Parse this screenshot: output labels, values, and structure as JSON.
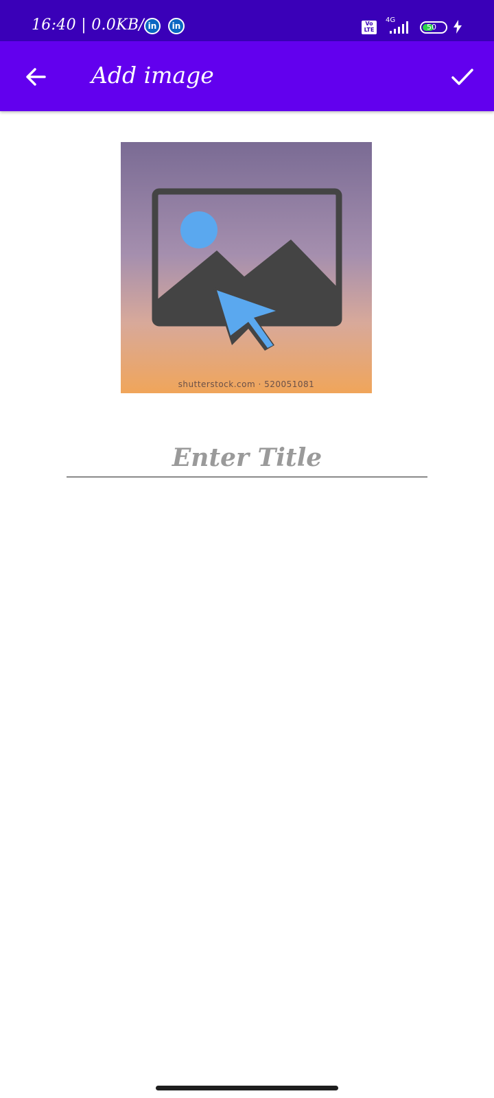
{
  "status_bar": {
    "time_speed": "16:40 | 0.0KB/s",
    "notification_icons": [
      "linkedin-icon",
      "linkedin-icon"
    ],
    "volte_label": "Vo LTE",
    "network_type": "4G",
    "battery_level": "50",
    "charging": true
  },
  "app_bar": {
    "title": "Add image",
    "back_icon": "arrow-left-icon",
    "confirm_icon": "check-icon"
  },
  "image_picker": {
    "watermark": "shutterstock.com · 520051081",
    "icon": "add-image-icon"
  },
  "title_input": {
    "placeholder": "Enter Title",
    "value": ""
  },
  "colors": {
    "status_bar": "#3a00b8",
    "app_bar": "#6200ee",
    "accent_blue": "#5aa8ef",
    "icon_gray": "#444444"
  }
}
